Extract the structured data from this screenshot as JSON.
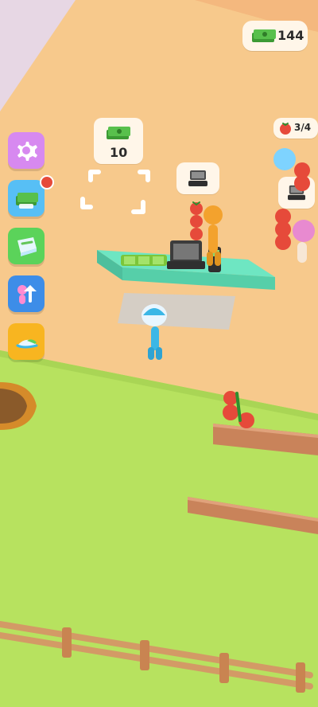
{
  "hud": {
    "cash_amount": "144",
    "cash_icon": "cash-stack-icon"
  },
  "build_spot": {
    "cost": "10",
    "cost_icon": "cash-stack-icon"
  },
  "customer_queue": {
    "tomato_progress": "3/4",
    "tomato_icon": "tomato-icon",
    "register_icon": "cash-register-icon"
  },
  "left_menu": {
    "buttons": [
      {
        "name": "settings",
        "icon": "gear-icon"
      },
      {
        "name": "cash-upgrade",
        "icon": "cash-stack-icon",
        "has_notification": true
      },
      {
        "name": "map",
        "icon": "map-icon"
      },
      {
        "name": "staff-upgrade",
        "icon": "staff-upgrade-icon"
      },
      {
        "name": "hat-shop",
        "icon": "cap-icon"
      }
    ]
  },
  "colors": {
    "floor": "#f7c98c",
    "grass": "#b7e25f",
    "counter": "#6ee6c2",
    "fence": "#d39a66",
    "accent_red": "#e64a3a",
    "ui_cream": "#fff6e9"
  }
}
